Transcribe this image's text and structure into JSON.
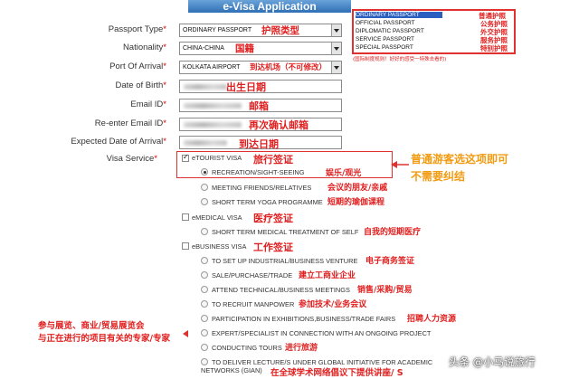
{
  "header": {
    "title": "e-Visa Application"
  },
  "form": {
    "passport_type": {
      "label": "Passport Type",
      "value": "ORDINARY PASSPORT",
      "note": "护照类型"
    },
    "nationality": {
      "label": "Nationality",
      "value": "CHINA-CHINA",
      "note": "国籍"
    },
    "port_of_arrival": {
      "label": "Port Of Arrival",
      "value": "KOLKATA AIRPORT",
      "note": "到达机场（不可修改）"
    },
    "date_of_birth": {
      "label": "Date of Birth",
      "note": "出生日期"
    },
    "email": {
      "label": "Email ID",
      "note": "邮箱"
    },
    "reenter_email": {
      "label": "Re-enter Email ID",
      "note": "再次确认邮箱"
    },
    "expected_date": {
      "label": "Expected Date of Arrival",
      "note": "到达日期"
    },
    "visa_service": {
      "label": "Visa Service"
    },
    "required_mark": "*"
  },
  "passport_dropdown": {
    "items": [
      {
        "en": "ORDINARY PASSPORT",
        "cn": "普通护照"
      },
      {
        "en": "OFFICIAL PASSPORT",
        "cn": "公务护照"
      },
      {
        "en": "DIPLOMATIC PASSPORT",
        "cn": "外交护照"
      },
      {
        "en": "SERVICE PASSPORT",
        "cn": "服务护照"
      },
      {
        "en": "SPECIAL PASSPORT",
        "cn": "特别护照"
      }
    ],
    "footnote": "(国际制度规则！好好的感受一特殊去看的)"
  },
  "visa": {
    "etourist": {
      "label": "eTOURIST VISA",
      "note": "旅行签证",
      "options": [
        {
          "label": "RECREATION/SIGHT-SEEING",
          "note": "娱乐/观光"
        },
        {
          "label": "MEETING FRIENDS/RELATIVES",
          "note": "会议的朋友/亲戚"
        },
        {
          "label": "SHORT TERM YOGA PROGRAMME",
          "note": "短期的瑜伽课程"
        }
      ]
    },
    "emedical": {
      "label": "eMEDICAL VISA",
      "note": "医疗签证",
      "options": [
        {
          "label": "SHORT TERM MEDICAL TREATMENT OF SELF",
          "note": "自我的短期医疗"
        }
      ]
    },
    "ebusiness": {
      "label": "eBUSINESS VISA",
      "note": "工作签证",
      "options": [
        {
          "label": "TO SET UP INDUSTRIAL/BUSINESS VENTURE",
          "note": "电子商务签证"
        },
        {
          "label": "SALE/PURCHASE/TRADE",
          "note": "建立工商业企业"
        },
        {
          "label": "ATTEND TECHNICAL/BUSINESS MEETINGS",
          "note": "销售/采购/贸易"
        },
        {
          "label": "TO RECRUIT MANPOWER",
          "note": "参加技术/业务会议"
        },
        {
          "label": "PARTICIPATION IN EXHIBITIONS,BUSINESS/TRADE FAIRS",
          "note": "招聘人力资源"
        },
        {
          "label": "EXPERT/SPECIALIST IN CONNECTION WITH AN ONGOING PROJECT",
          "note": ""
        },
        {
          "label": "CONDUCTING TOURS",
          "note": "进行旅游"
        },
        {
          "label": "TO DELIVER LECTURE/S UNDER GLOBAL INITIATIVE FOR ACADEMIC",
          "label2": "NETWORKS (GIAN)",
          "note": "在全球学术网络倡议下提供讲座/ S"
        }
      ]
    }
  },
  "annotations": {
    "tourist_tip_line1": "普通游客选这项即可",
    "tourist_tip_line2": "不需要纠结",
    "left_note_line1": "参与展览、商业/贸易展览会",
    "left_note_line2": "与正在进行的项目有关的专家/专家"
  },
  "watermark": "头条 @小马说旅行",
  "colors": {
    "annotation_red": "#e02020",
    "annotation_orange": "#f29b11",
    "header_blue": "#2f6fb5",
    "selected_blue": "#2a5fbf"
  }
}
